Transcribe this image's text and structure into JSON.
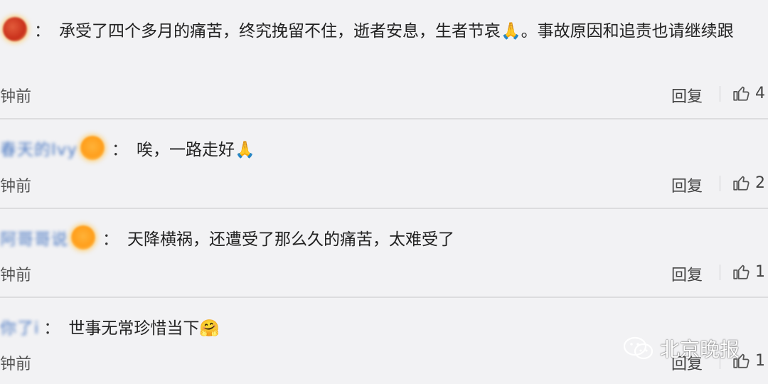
{
  "comments": [
    {
      "user": "",
      "text": "承受了四个多月的痛苦，终究挽留不住，逝者安息，生者节哀🙏。事故原因和追责也请继续跟",
      "time": "钟前",
      "reply": "回复",
      "likes": "4"
    },
    {
      "user": "春天的Ivy",
      "text": "唉，一路走好🙏",
      "time": "钟前",
      "reply": "回复",
      "likes": "2"
    },
    {
      "user": "阿哥哥说",
      "text": "天降横祸，还遭受了那么久的痛苦，太难受了",
      "time": "钟前",
      "reply": "回复",
      "likes": "1"
    },
    {
      "user": "你了i",
      "text": "世事无常珍惜当下🤗",
      "time": "钟前",
      "reply": "回复",
      "likes": "1"
    }
  ],
  "colon": "：",
  "watermark": "北京晚报",
  "icons": {
    "like": "thumbs-up-icon",
    "watermark": "wechat-icon"
  },
  "colors": {
    "username": "#4a78c2",
    "background": "#f2f2f4"
  }
}
